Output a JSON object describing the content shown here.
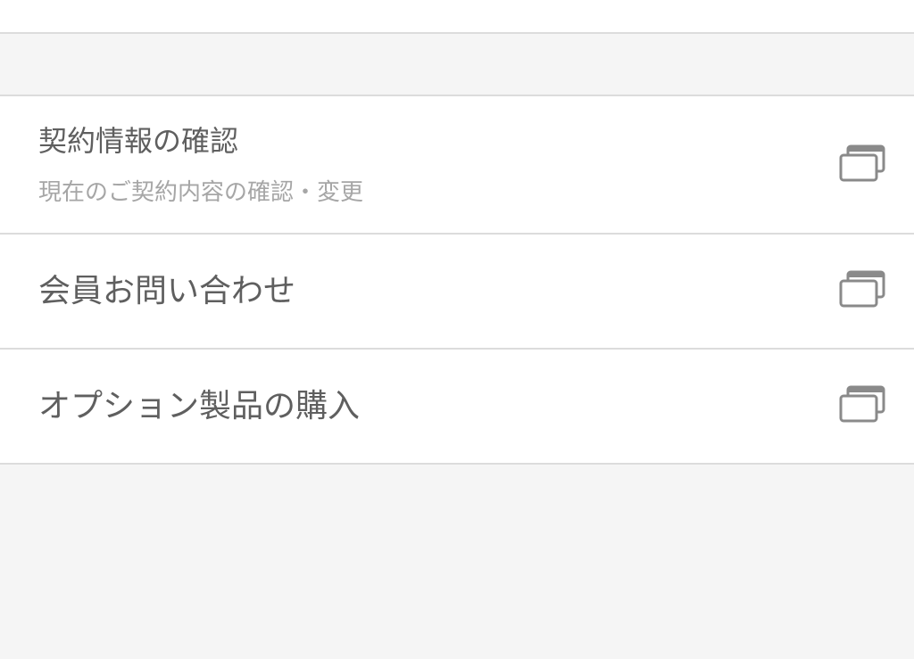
{
  "menu": {
    "items": [
      {
        "title": "契約情報の確認",
        "subtitle": "現在のご契約内容の確認・変更",
        "icon": "external-window-icon"
      },
      {
        "title": "会員お問い合わせ",
        "icon": "external-window-icon"
      },
      {
        "title": "オプション製品の購入",
        "icon": "external-window-icon"
      }
    ]
  },
  "colors": {
    "background": "#f5f5f5",
    "surface": "#ffffff",
    "divider": "#dcdcdc",
    "title_text": "#5f5f5f",
    "subtitle_text": "#a6a6a6",
    "icon": "#8a8a8a"
  }
}
